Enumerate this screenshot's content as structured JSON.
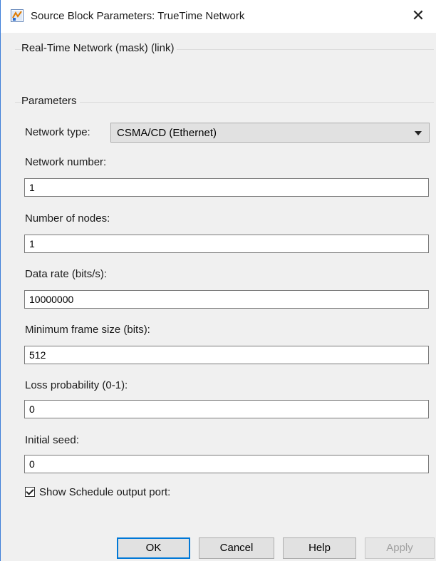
{
  "window": {
    "title": "Source Block Parameters: TrueTime Network",
    "close_glyph": "✕",
    "icon": "simulink-block-icon"
  },
  "mask_group": {
    "label": "Real-Time Network (mask) (link)"
  },
  "parameters_group": {
    "label": "Parameters"
  },
  "network_type": {
    "label": "Network type:",
    "selected": "CSMA/CD (Ethernet)"
  },
  "fields": {
    "network_number": {
      "label": "Network number:",
      "value": "1"
    },
    "number_of_nodes": {
      "label": "Number of nodes:",
      "value": "1"
    },
    "data_rate": {
      "label": "Data rate (bits/s):",
      "value": "10000000"
    },
    "min_frame_size": {
      "label": "Minimum frame size (bits):",
      "value": "512"
    },
    "loss_probability": {
      "label": "Loss probability (0-1):",
      "value": "0"
    },
    "initial_seed": {
      "label": "Initial seed:",
      "value": "0"
    }
  },
  "schedule_output": {
    "label": "Show Schedule output port:",
    "checked": true
  },
  "buttons": {
    "ok": "OK",
    "cancel": "Cancel",
    "help": "Help",
    "apply": "Apply"
  },
  "colors": {
    "accent": "#0078d7",
    "window_bg": "#f0f0f0",
    "button_bg": "#e1e1e1"
  }
}
